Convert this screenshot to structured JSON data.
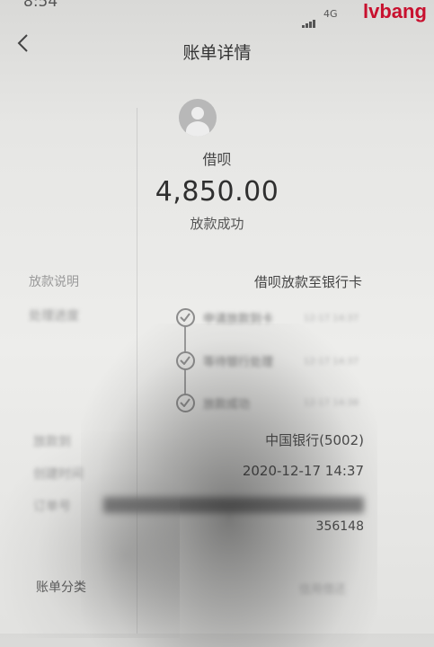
{
  "status_bar": {
    "time": "8:54",
    "network": "4G"
  },
  "watermark": "lvbang",
  "header": {
    "title": "账单详情"
  },
  "summary": {
    "merchant": "借呗",
    "amount": "4,850.00",
    "status": "放款成功"
  },
  "details": {
    "desc_label": "放款说明",
    "desc_value": "借呗放款至银行卡",
    "progress_label": "处理进度",
    "steps": [
      {
        "text": "申请放款到卡",
        "time": "12-17 14:37"
      },
      {
        "text": "等待银行处理",
        "time": "12-17 14:37"
      },
      {
        "text": "放款成功",
        "time": "12-17 14:38"
      }
    ],
    "account_label": "放款到",
    "account_value": "中国银行(5002)",
    "time_label": "创建时间",
    "time_value": "2020-12-17 14:37",
    "order_label": "订单号",
    "order_suffix": "356148",
    "category_label": "账单分类",
    "category_value": "信用借还"
  },
  "colors": {
    "watermark": "#c8102e",
    "background": "#e6e6e4"
  }
}
